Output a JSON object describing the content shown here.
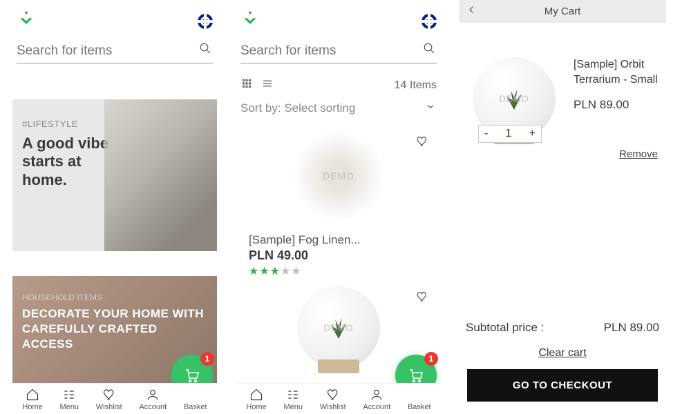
{
  "common": {
    "search_placeholder": "Search for items",
    "nav": {
      "home": "Home",
      "menu": "Menu",
      "wishlist": "Wishlist",
      "account": "Account",
      "basket": "Basket"
    },
    "basket_badge": "1"
  },
  "home": {
    "card1": {
      "tag": "#LIFESTYLE",
      "headline": "A good vibe starts at home."
    },
    "card2": {
      "tag": "HOUSEHOLD ITEMS",
      "headline": "DECORATE YOUR HOME WITH CAREFULLY CRAFTED ACCESS"
    }
  },
  "listing": {
    "count_label": "14 Items",
    "sort_prefix": "Sort by:",
    "sort_value": "Select sorting",
    "product1": {
      "name": "[Sample] Fog Linen...",
      "price": "PLN 49.00"
    }
  },
  "cart": {
    "title": "My Cart",
    "item": {
      "name": "[Sample] Orbit Terrarium - Small",
      "price": "PLN 89.00",
      "qty": "1"
    },
    "qty_minus": "-",
    "qty_plus": "+",
    "remove": "Remove",
    "subtotal_label": "Subtotal price :",
    "subtotal_value": "PLN 89.00",
    "clear": "Clear cart",
    "checkout": "GO TO CHECKOUT"
  }
}
